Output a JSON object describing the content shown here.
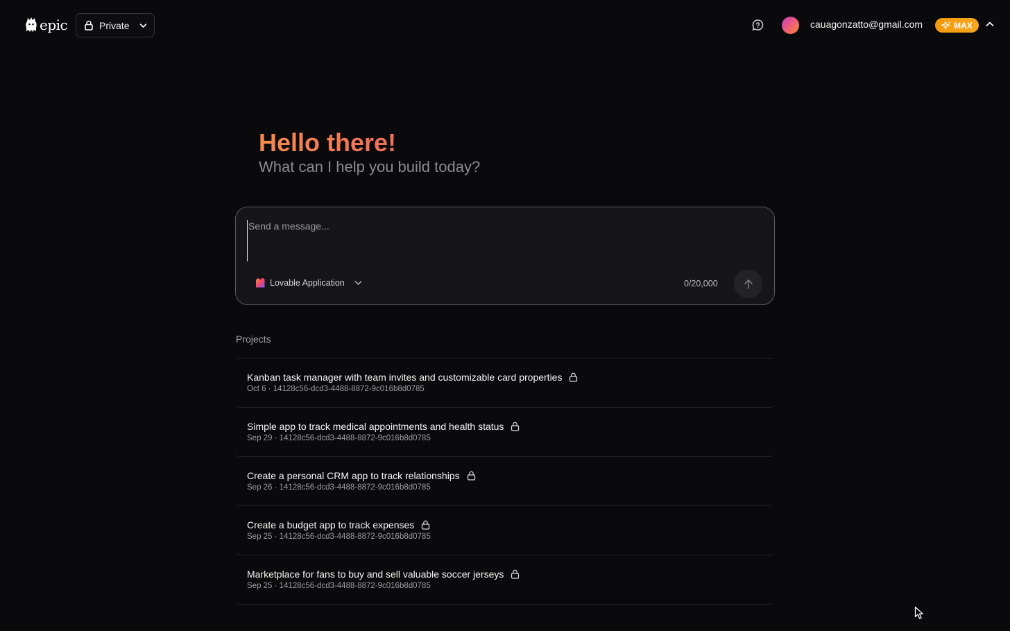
{
  "header": {
    "logo_text": "epic",
    "visibility_label": "Private",
    "feedback_icon": "chat-bubble-icon",
    "user_email": "cauagonzatto@gmail.com",
    "plan_badge": "MAX"
  },
  "hero": {
    "title": "Hello there!",
    "subtitle": "What can I help you build today?"
  },
  "composer": {
    "placeholder": "Send a message...",
    "value": "",
    "template_label": "Lovable Application",
    "char_counter": "0/20,000",
    "send_icon": "arrow-up-icon"
  },
  "projects": {
    "heading": "Projects",
    "items": [
      {
        "title": "Kanban task manager with team invites and customizable card properties",
        "meta": "Oct 6 · 14128c56-dcd3-4488-8872-9c016b8d0785"
      },
      {
        "title": "Simple app to track medical appointments and health status",
        "meta": "Sep 29 · 14128c56-dcd3-4488-8872-9c016b8d0785"
      },
      {
        "title": "Create a personal CRM app to track relationships",
        "meta": "Sep 26 · 14128c56-dcd3-4488-8872-9c016b8d0785"
      },
      {
        "title": "Create a budget app to track expenses",
        "meta": "Sep 25 · 14128c56-dcd3-4488-8872-9c016b8d0785"
      },
      {
        "title": "Marketplace for fans to buy and sell valuable soccer jerseys",
        "meta": "Sep 25 · 14128c56-dcd3-4488-8872-9c016b8d0785"
      }
    ]
  },
  "colors": {
    "background": "#0a0a0c",
    "accent_orange": "#f58a4d",
    "badge_orange": "#f59a0a"
  }
}
